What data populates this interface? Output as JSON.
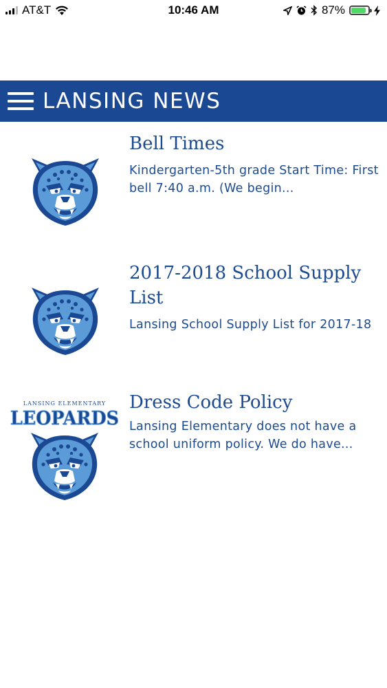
{
  "status_bar": {
    "carrier": "AT&T",
    "time": "10:46 AM",
    "battery_percent": "87%",
    "battery_level": 0.87,
    "icons": [
      "signal-icon",
      "wifi-icon",
      "location-icon",
      "alarm-icon",
      "bluetooth-icon",
      "battery-icon",
      "charging-icon"
    ]
  },
  "header": {
    "title": "LANSING NEWS",
    "background_color": "#1b4893",
    "menu_icon": "hamburger-menu-icon"
  },
  "colors": {
    "accent": "#1b4893",
    "text": "#1c4a8f",
    "logo_light_blue": "#5b9bd8"
  },
  "news_items": [
    {
      "title": "Bell Times",
      "summary": "Kindergarten-5th grade Start Time: First bell 7:40 a.m. (We begin...",
      "image": "leopard-mascot-icon"
    },
    {
      "title": "2017-2018 School Supply List",
      "summary": "Lansing School Supply List for 2017-18",
      "image": "leopard-mascot-icon"
    },
    {
      "title": "Dress Code Policy",
      "summary": "Lansing Elementary does not have a school uniform policy. We do have...",
      "image": "leopards-logo-icon",
      "logo_text_small": "LANSING ELEMENTARY",
      "logo_text_large": "LEOPARDS"
    }
  ]
}
